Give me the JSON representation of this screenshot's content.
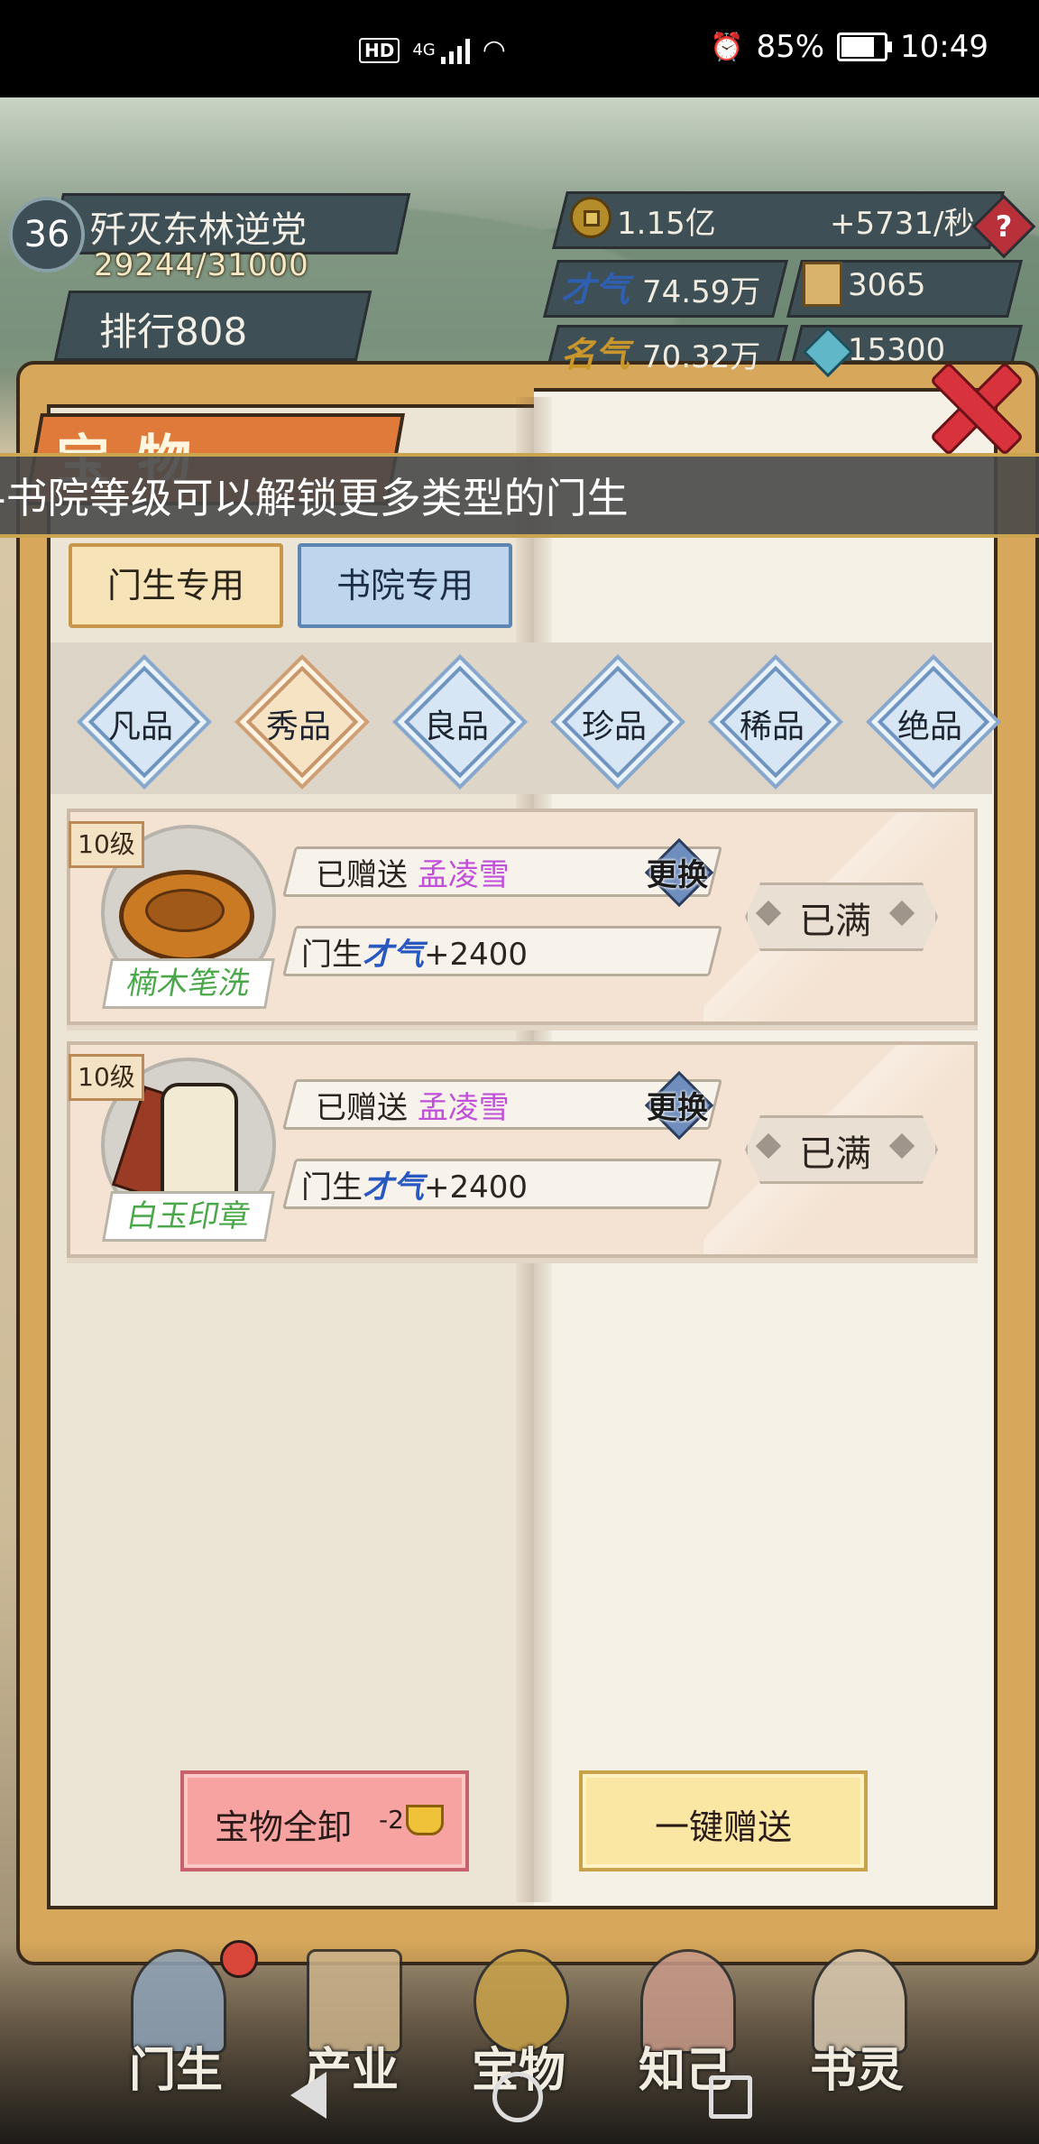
{
  "status_bar": {
    "network": "HD",
    "signal": "4G",
    "battery": "85%",
    "battery_level": 0.85,
    "time": "10:49"
  },
  "hud": {
    "level": "36",
    "quest_title": "歼灭东林逆党",
    "quest_progress": "29244/31000",
    "rank_label": "排行",
    "rank_value": "808",
    "coins": "1.15亿",
    "coin_rate": "+5731/秒",
    "help": "?",
    "talent_icon": "才气",
    "talent_value": "74.59万",
    "book_value": "3065",
    "fame_icon": "名气",
    "fame_value": "70.32万",
    "gem_value": "15300"
  },
  "dialog": {
    "title": "宝物",
    "notice": "书院等级可以解锁更多类型的门生",
    "tabs": [
      {
        "label": "门生专用",
        "active": false
      },
      {
        "label": "书院专用",
        "active": true
      }
    ],
    "grades": [
      {
        "label": "凡品",
        "active": false
      },
      {
        "label": "秀品",
        "active": true
      },
      {
        "label": "良品",
        "active": false
      },
      {
        "label": "珍品",
        "active": false
      },
      {
        "label": "稀品",
        "active": false
      },
      {
        "label": "绝品",
        "active": false
      }
    ],
    "items": [
      {
        "level": "10级",
        "name": "楠木笔洗",
        "gifted_prefix": "已赠送",
        "gifted_to": "孟凌雪",
        "swap_label": "更换",
        "bonus_prefix": "门生",
        "bonus_icon": "才气",
        "bonus_value": "+2400",
        "status": "已满",
        "icon": "wooden-brush-washer-icon"
      },
      {
        "level": "10级",
        "name": "白玉印章",
        "gifted_prefix": "已赠送",
        "gifted_to": "孟凌雪",
        "swap_label": "更换",
        "bonus_prefix": "门生",
        "bonus_icon": "才气",
        "bonus_value": "+2400",
        "status": "已满",
        "icon": "jade-seal-icon"
      }
    ],
    "unequip_all": {
      "label": "宝物全卸",
      "cost": "-2",
      "cost_icon": "gold-ingot-icon"
    },
    "gift_all": {
      "label": "一键赠送"
    }
  },
  "bottom_nav": [
    {
      "label": "门生",
      "badge": true
    },
    {
      "label": "产业",
      "badge": false
    },
    {
      "label": "宝物",
      "badge": false
    },
    {
      "label": "知己",
      "badge": false
    },
    {
      "label": "书灵",
      "badge": false
    }
  ],
  "colors": {
    "accent_gift_name": "#c050d8",
    "item_name": "#4aa84a",
    "close": "#d8323c"
  }
}
